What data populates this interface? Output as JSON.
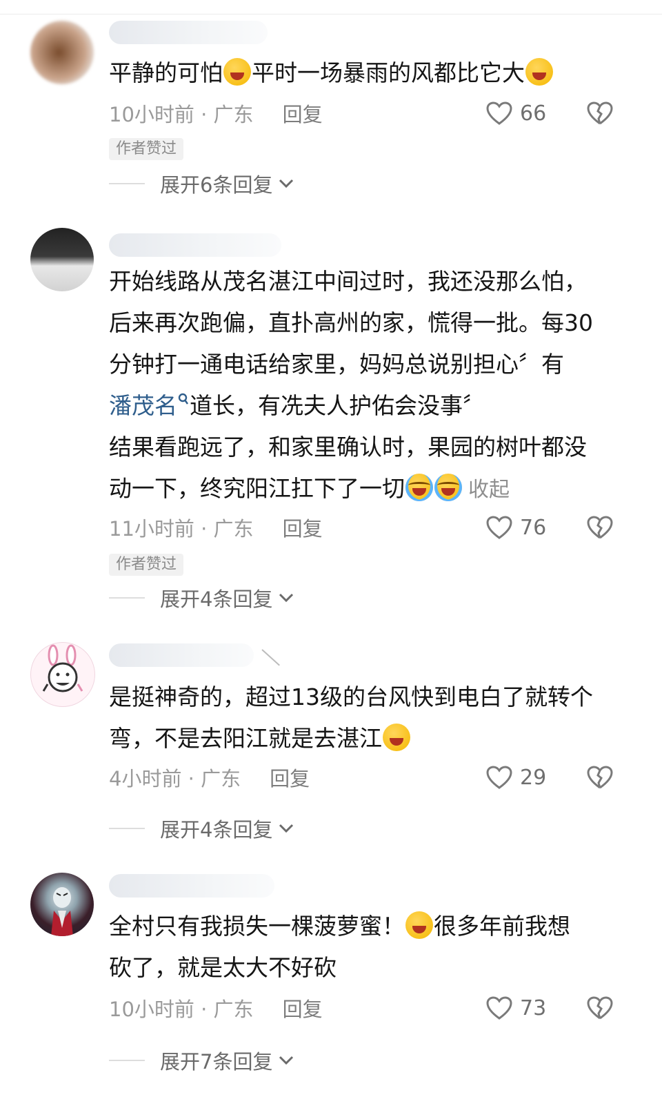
{
  "comments": [
    {
      "text_parts": [
        "平静的可怕",
        "平时一场暴雨的风都比它大"
      ],
      "time": "10小时前 · 广东",
      "reply": "回复",
      "likes": "66",
      "tag": "作者赞过",
      "expand": "展开6条回复"
    },
    {
      "line1": "开始线路从茂名湛江中间过时，我还没那么怕，",
      "line2": "后来再次跑偏，直扑高州的家，慌得一批。每30",
      "line3": "分钟打一通电话给家里，妈妈总说别担心〞有",
      "link": "潘茂名",
      "line4_rest": "道长，有冼夫人护佑会没事〞",
      "line5": "结果看跑远了，和家里确认时，果园的树叶都没",
      "line6": "动一下，终究阳江扛下了一切",
      "collapse": "收起",
      "time": "11小时前 · 广东",
      "reply": "回复",
      "likes": "76",
      "tag": "作者赞过",
      "expand": "展开4条回复"
    },
    {
      "line1": "是挺神奇的，超过13级的台风快到电白了就转个",
      "line2": "弯，不是去阳江就是去湛江",
      "time": "4小时前 · 广东",
      "reply": "回复",
      "likes": "29",
      "expand": "展开4条回复"
    },
    {
      "line1a": "全村只有我损失一棵菠萝蜜！",
      "line1b": "很多年前我想",
      "line2": "砍了，就是太大不好砍",
      "time": "10小时前 · 广东",
      "reply": "回复",
      "likes": "73",
      "expand": "展开7条回复"
    }
  ],
  "icons": {
    "like": "heart-outline-icon",
    "dislike": "broken-heart-icon",
    "expand": "chevron-down-icon",
    "emoji_laugh": "rofl-emoji",
    "emoji_cry": "crying-emoji",
    "search": "search-icon"
  },
  "colors": {
    "link": "#2f5e8c",
    "meta": "#9a9a9a",
    "tag_bg": "#f1f1f1"
  }
}
